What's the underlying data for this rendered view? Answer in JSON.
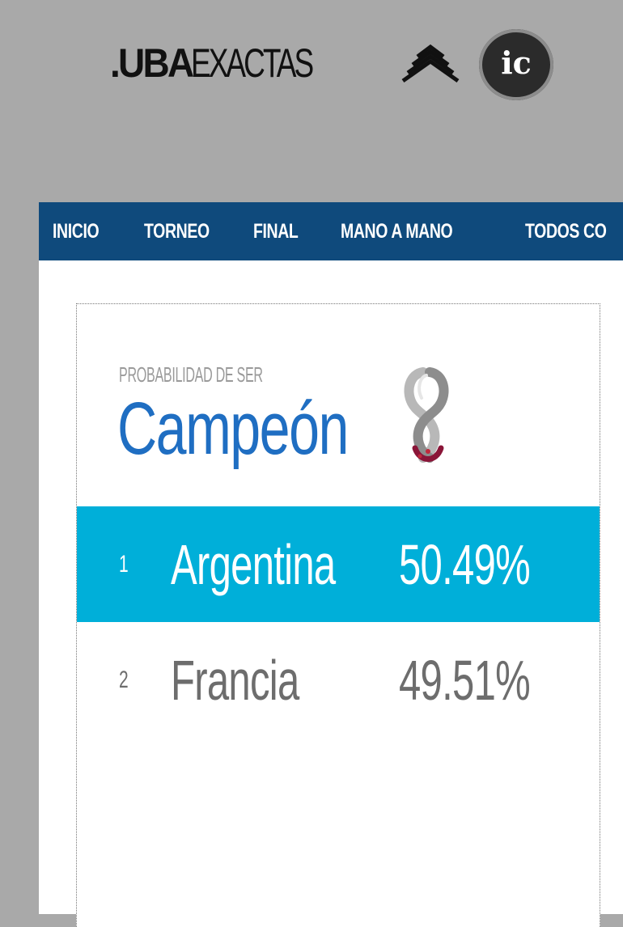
{
  "header": {
    "logo_uba": ".UBA",
    "logo_exactas": "EXACTAS",
    "badge_text": "ic"
  },
  "nav": {
    "items": [
      "INICIO",
      "TORNEO",
      "FINAL",
      "MANO A MANO",
      "TODOS CO"
    ]
  },
  "card": {
    "kicker": "PROBABILIDAD DE SER",
    "title": "Campeón",
    "icon": "world-cup-trophy-icon",
    "rows": [
      {
        "rank": "1",
        "team": "Argentina",
        "probability": "50.49%"
      },
      {
        "rank": "2",
        "team": "Francia",
        "probability": "49.51%"
      }
    ]
  },
  "colors": {
    "page_background": "#a9a9a9",
    "nav_background": "#0f4a7c",
    "title": "#1f6ec2",
    "highlight_row": "#00afd9",
    "muted_text": "#6d6d6d"
  }
}
